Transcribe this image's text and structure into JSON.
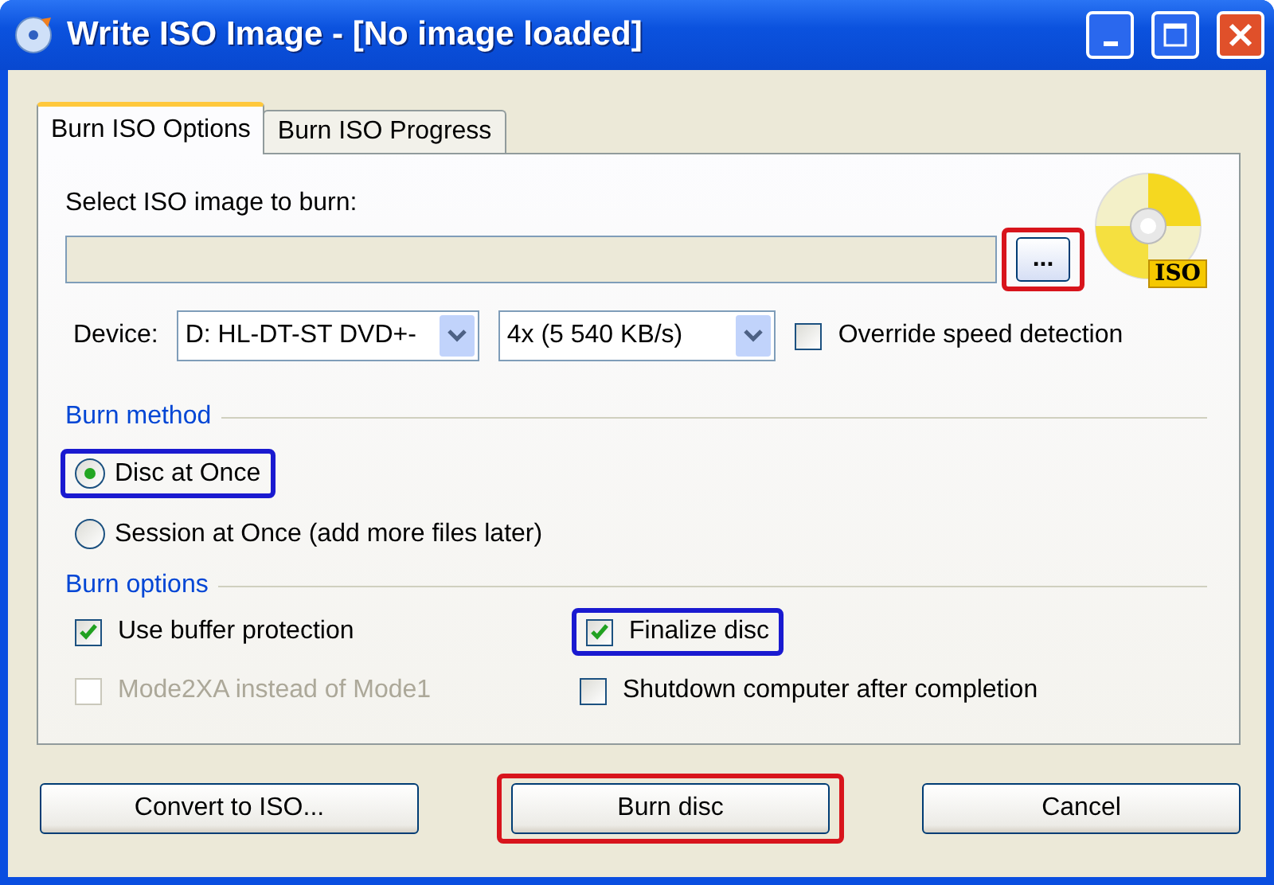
{
  "window": {
    "title": "Write ISO Image - [No image loaded]"
  },
  "tabs": [
    {
      "label": "Burn ISO Options",
      "selected": true
    },
    {
      "label": "Burn ISO Progress",
      "selected": false
    }
  ],
  "image_select": {
    "label": "Select ISO image to burn:",
    "browse_button": "...",
    "color": "#d8141c"
  },
  "iso_badge": "ISO",
  "device": {
    "label": "Device:",
    "value": "D: HL-DT-ST DVD+-"
  },
  "speed": {
    "value": "4x (5 540 KB/s)"
  },
  "override_speed": {
    "label": "Override speed detection",
    "checked": false
  },
  "burn_method": {
    "title": "Burn method",
    "options": [
      {
        "label": "Disc at Once",
        "selected": true,
        "color": "#1a1ad0"
      },
      {
        "label": "Session at Once (add more files later)",
        "selected": false
      }
    ]
  },
  "burn_options": {
    "title": "Burn options",
    "items": [
      {
        "label": "Use buffer protection",
        "checked": true,
        "disabled": false
      },
      {
        "label": "Finalize disc",
        "checked": true,
        "disabled": false,
        "color": "#1a1ad0"
      },
      {
        "label": "Mode2XA instead of Mode1",
        "checked": false,
        "disabled": true
      },
      {
        "label": "Shutdown computer after completion",
        "checked": false,
        "disabled": false
      }
    ]
  },
  "buttons": [
    {
      "label": "Convert to ISO..."
    },
    {
      "label": "Burn disc",
      "color": "#d8141c"
    },
    {
      "label": "Cancel"
    }
  ]
}
